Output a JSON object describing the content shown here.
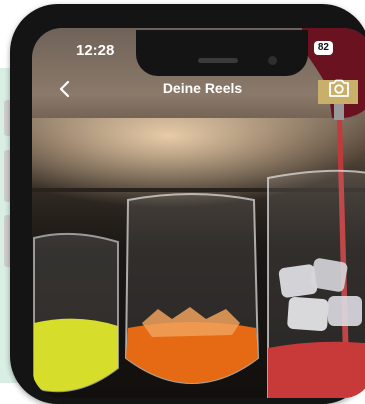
{
  "status_bar": {
    "time": "12:28",
    "battery": "82"
  },
  "header": {
    "title": "Deine Reels"
  },
  "icons": {
    "back": "chevron-left-icon",
    "camera": "camera-icon",
    "wifi": "wifi-icon",
    "battery": "battery-icon"
  },
  "colors": {
    "mint": "#d9efe4",
    "phone_frame": "#141414",
    "drink_yellow": "#d7dd2b",
    "drink_orange": "#e66a14",
    "drink_red": "#c83a3a"
  }
}
